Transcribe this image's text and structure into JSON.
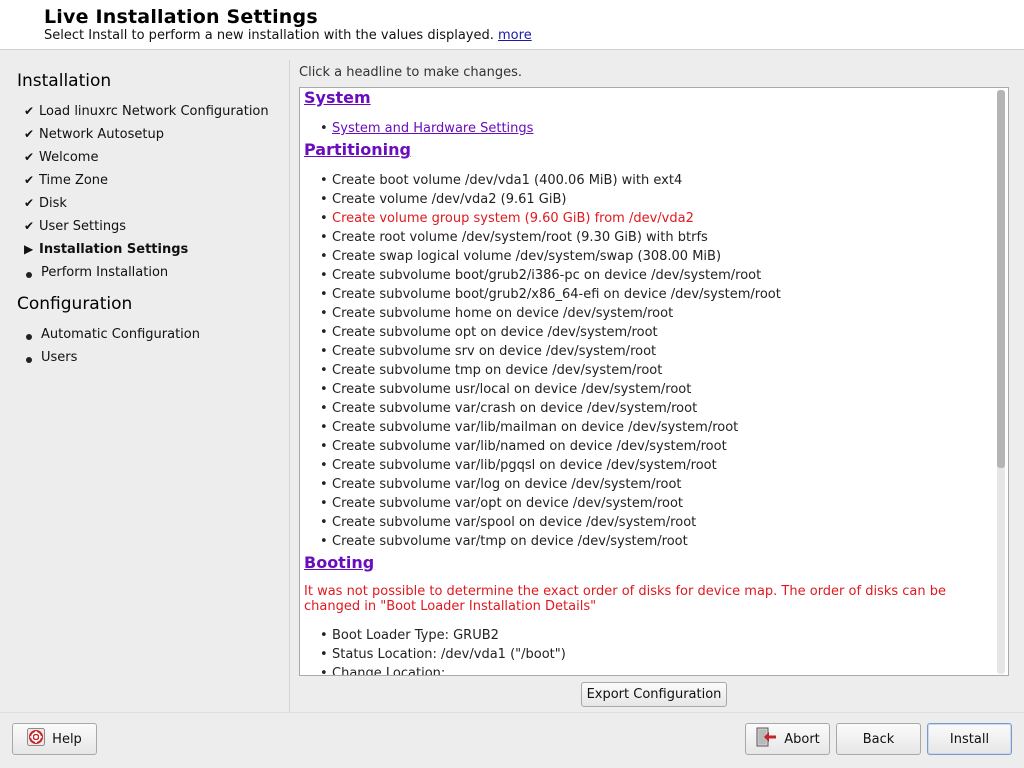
{
  "header": {
    "title": "Live Installation Settings",
    "subtitle": "Select Install to perform a new installation with the values displayed.",
    "more_link": "more"
  },
  "sidebar": {
    "installation_title": "Installation",
    "installation_steps": [
      {
        "label": "Load linuxrc Network Configuration",
        "state": "done"
      },
      {
        "label": "Network Autosetup",
        "state": "done"
      },
      {
        "label": "Welcome",
        "state": "done"
      },
      {
        "label": "Time Zone",
        "state": "done"
      },
      {
        "label": "Disk",
        "state": "done"
      },
      {
        "label": "User Settings",
        "state": "done"
      },
      {
        "label": "Installation Settings",
        "state": "current"
      },
      {
        "label": "Perform Installation",
        "state": "todo"
      }
    ],
    "configuration_title": "Configuration",
    "configuration_steps": [
      {
        "label": "Automatic Configuration"
      },
      {
        "label": "Users"
      }
    ]
  },
  "main": {
    "hint": "Click a headline to make changes.",
    "system": {
      "heading": "System",
      "items": [
        "System and Hardware Settings"
      ]
    },
    "partitioning": {
      "heading": "Partitioning",
      "items": [
        {
          "text": "Create boot volume /dev/vda1 (400.06 MiB) with ext4",
          "warn": false
        },
        {
          "text": "Create volume /dev/vda2 (9.61 GiB)",
          "warn": false
        },
        {
          "text": "Create volume group system (9.60 GiB) from /dev/vda2",
          "warn": true
        },
        {
          "text": "Create root volume /dev/system/root (9.30 GiB) with btrfs",
          "warn": false
        },
        {
          "text": "Create swap logical volume /dev/system/swap (308.00 MiB)",
          "warn": false
        },
        {
          "text": "Create subvolume boot/grub2/i386-pc on device /dev/system/root",
          "warn": false
        },
        {
          "text": "Create subvolume boot/grub2/x86_64-efi on device /dev/system/root",
          "warn": false
        },
        {
          "text": "Create subvolume home on device /dev/system/root",
          "warn": false
        },
        {
          "text": "Create subvolume opt on device /dev/system/root",
          "warn": false
        },
        {
          "text": "Create subvolume srv on device /dev/system/root",
          "warn": false
        },
        {
          "text": "Create subvolume tmp on device /dev/system/root",
          "warn": false
        },
        {
          "text": "Create subvolume usr/local on device /dev/system/root",
          "warn": false
        },
        {
          "text": "Create subvolume var/crash on device /dev/system/root",
          "warn": false
        },
        {
          "text": "Create subvolume var/lib/mailman on device /dev/system/root",
          "warn": false
        },
        {
          "text": "Create subvolume var/lib/named on device /dev/system/root",
          "warn": false
        },
        {
          "text": "Create subvolume var/lib/pgqsl on device /dev/system/root",
          "warn": false
        },
        {
          "text": "Create subvolume var/log on device /dev/system/root",
          "warn": false
        },
        {
          "text": "Create subvolume var/opt on device /dev/system/root",
          "warn": false
        },
        {
          "text": "Create subvolume var/spool on device /dev/system/root",
          "warn": false
        },
        {
          "text": "Create subvolume var/tmp on device /dev/system/root",
          "warn": false
        }
      ]
    },
    "booting": {
      "heading": "Booting",
      "warning": "It was not possible to determine the exact order of disks for device map. The order of disks can be changed in \"Boot Loader Installation Details\"",
      "items": [
        "Boot Loader Type: GRUB2",
        "Status Location: /dev/vda1 (\"/boot\")",
        "Change Location:"
      ]
    },
    "export_button": "Export Configuration"
  },
  "footer": {
    "help": "Help",
    "abort": "Abort",
    "back": "Back",
    "install": "Install"
  },
  "colors": {
    "link": "#6a0dbd",
    "warning": "#e0191f",
    "background": "#ededed"
  }
}
